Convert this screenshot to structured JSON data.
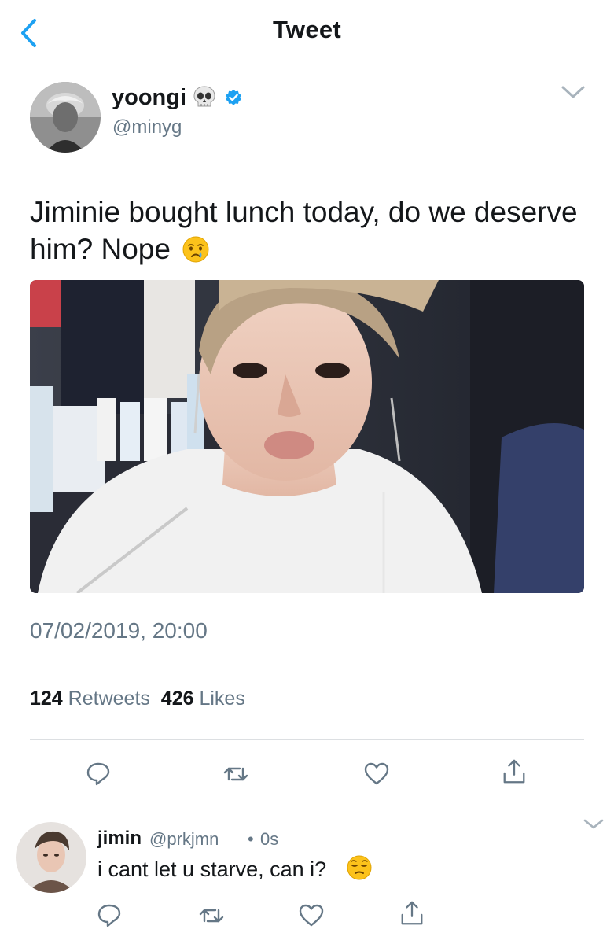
{
  "header": {
    "title": "Tweet",
    "back_icon": "chevron-left-icon"
  },
  "tweet": {
    "display_name": "yoongi",
    "name_emoji": "skull",
    "verified": true,
    "handle": "@minyg",
    "text": "Jiminie bought lunch today, do we deserve him? Nope",
    "text_emoji": "crying-face",
    "timestamp": "07/02/2019, 20:00",
    "retweets_count": "124",
    "retweets_label": "Retweets",
    "likes_count": "426",
    "likes_label": "Likes",
    "actions": [
      "reply-icon",
      "retweet-icon",
      "like-icon",
      "share-icon"
    ]
  },
  "reply": {
    "display_name": "jimin",
    "handle": "@prkjmn",
    "separator": "•",
    "time": "0s",
    "text": "i cant let u starve, can i?",
    "text_emoji": "pensive-face",
    "actions": [
      "reply-icon",
      "retweet-icon",
      "like-icon",
      "share-icon"
    ]
  },
  "colors": {
    "accent": "#1da1f2",
    "text_primary": "#14171a",
    "text_secondary": "#657786",
    "divider": "#dcdfe2"
  }
}
